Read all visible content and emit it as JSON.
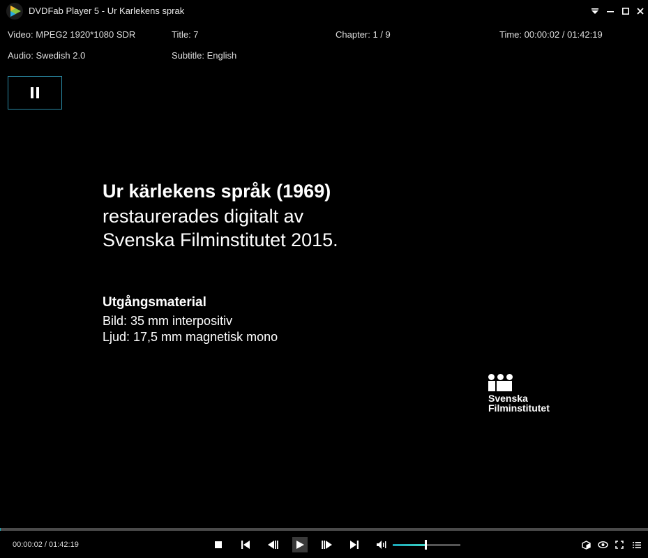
{
  "window": {
    "title": "DVDFab Player 5 - Ur Karlekens sprak",
    "controls": [
      "menu-dropdown-icon",
      "minimize-icon",
      "maximize-icon",
      "close-icon"
    ]
  },
  "info": {
    "video": "Video: MPEG2  1920*1080 SDR",
    "title": "Title: 7",
    "chapter": "Chapter: 1 / 9",
    "time": "Time: 00:00:02 / 01:42:19",
    "audio": "Audio: Swedish  2.0",
    "subtitle": "Subtitle: English"
  },
  "overlay": {
    "state_icon": "pause-icon"
  },
  "video_frame": {
    "title": "Ur kärlekens språk (1969)",
    "line1": "restaurerades digitalt av",
    "line2": "Svenska Filminstitutet 2015.",
    "section_heading": "Utgångsmaterial",
    "bild": "Bild: 35 mm interpositiv",
    "ljud": "Ljud: 17,5 mm magnetisk mono",
    "logo_line1": "Svenska",
    "logo_line2": "Filminstitutet"
  },
  "playback": {
    "time_readout": "00:00:02 / 01:42:19",
    "progress_fraction": 0.0003,
    "volume_fraction": 0.48,
    "accent_color": "#1aa6b7",
    "buttons": [
      "stop-icon",
      "previous-chapter-icon",
      "step-back-icon",
      "play-icon",
      "step-forward-icon",
      "next-chapter-icon",
      "volume-icon"
    ],
    "right_buttons": [
      "3d-box-icon",
      "eye-icon",
      "fullscreen-icon",
      "playlist-icon"
    ]
  }
}
